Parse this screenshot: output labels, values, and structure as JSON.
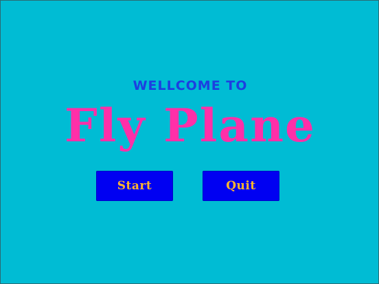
{
  "menu": {
    "welcome_text": "WELLCOME TO",
    "game_title": "Fly Plane",
    "start_label": "Start",
    "quit_label": "Quit"
  },
  "colors": {
    "background": "#00bcd4",
    "welcome_text": "#1d3fe0",
    "title_text": "#ff2fa8",
    "button_fill": "#0000f2",
    "button_text": "#ffb52e"
  }
}
